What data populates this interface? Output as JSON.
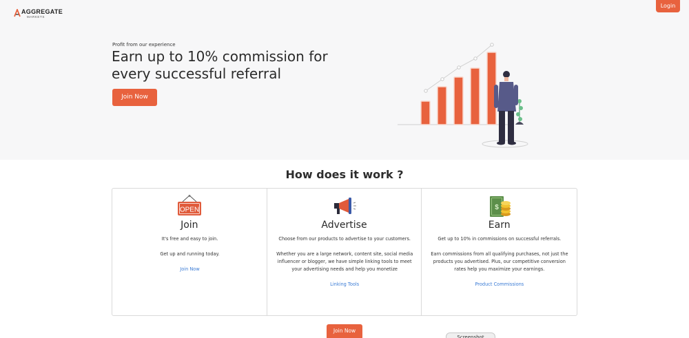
{
  "header": {
    "logo_text": "AGGREGATE",
    "logo_subtext": "MARKETS",
    "login_label": "Login"
  },
  "hero": {
    "eyebrow": "Profit from our experience",
    "headline": "Earn up to 10% commission for every successful referral",
    "cta_label": "Join Now"
  },
  "how": {
    "title": "How does it work ?",
    "cards": [
      {
        "icon": "open-sign-icon",
        "title": "Join",
        "paragraphs": [
          "It's free and easy to join.",
          "Get up and running today."
        ],
        "link": "Join Now"
      },
      {
        "icon": "megaphone-icon",
        "title": "Advertise",
        "paragraphs": [
          "Choose from our products to advertise to your customers.",
          "Whether you are a large network, content site, social media influencer or blogger, we have simple linking tools to meet your advertising needs and help you monetize"
        ],
        "link": "Linking Tools"
      },
      {
        "icon": "money-coins-icon",
        "title": "Earn",
        "paragraphs": [
          "Get up to 10% in commissions on successful referrals.",
          "Earn commissions from all qualifying purchases, not just the products you advertised. Plus, our competitive conversion rates help you maximize your earnings."
        ],
        "link": "Product Commissions"
      }
    ],
    "bottom_cta_label": "Join Now"
  },
  "overlay": {
    "screenshot_tab": "Screenshot"
  },
  "colors": {
    "accent": "#e8623e",
    "link": "#3a7bd5",
    "hero_bg": "#f7f7f8"
  }
}
